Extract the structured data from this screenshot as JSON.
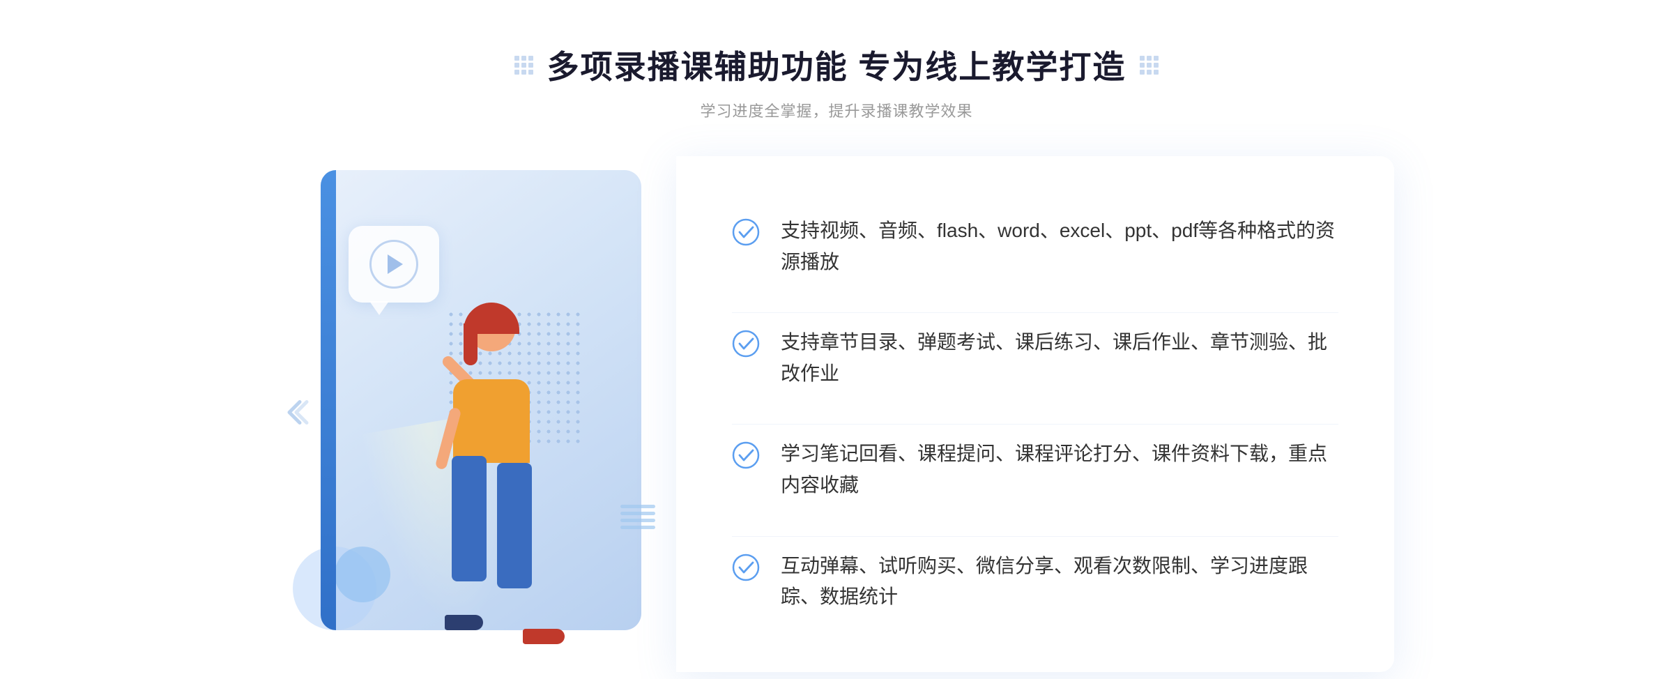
{
  "page": {
    "background": "#ffffff"
  },
  "header": {
    "main_title": "多项录播课辅助功能 专为线上教学打造",
    "sub_title": "学习进度全掌握，提升录播课教学效果"
  },
  "features": [
    {
      "id": "feature-1",
      "text": "支持视频、音频、flash、word、excel、ppt、pdf等各种格式的资源播放"
    },
    {
      "id": "feature-2",
      "text": "支持章节目录、弹题考试、课后练习、课后作业、章节测验、批改作业"
    },
    {
      "id": "feature-3",
      "text": "学习笔记回看、课程提问、课程评论打分、课件资料下载，重点内容收藏"
    },
    {
      "id": "feature-4",
      "text": "互动弹幕、试听购买、微信分享、观看次数限制、学习进度跟踪、数据统计"
    }
  ],
  "icons": {
    "check": "✓",
    "play": "▶",
    "chevron_left": "《"
  },
  "colors": {
    "primary_blue": "#4a90e2",
    "check_blue": "#5b9ef0",
    "title_color": "#1a1a2e",
    "text_color": "#333333",
    "sub_color": "#999999",
    "bg_card": "#e8f0fb"
  }
}
